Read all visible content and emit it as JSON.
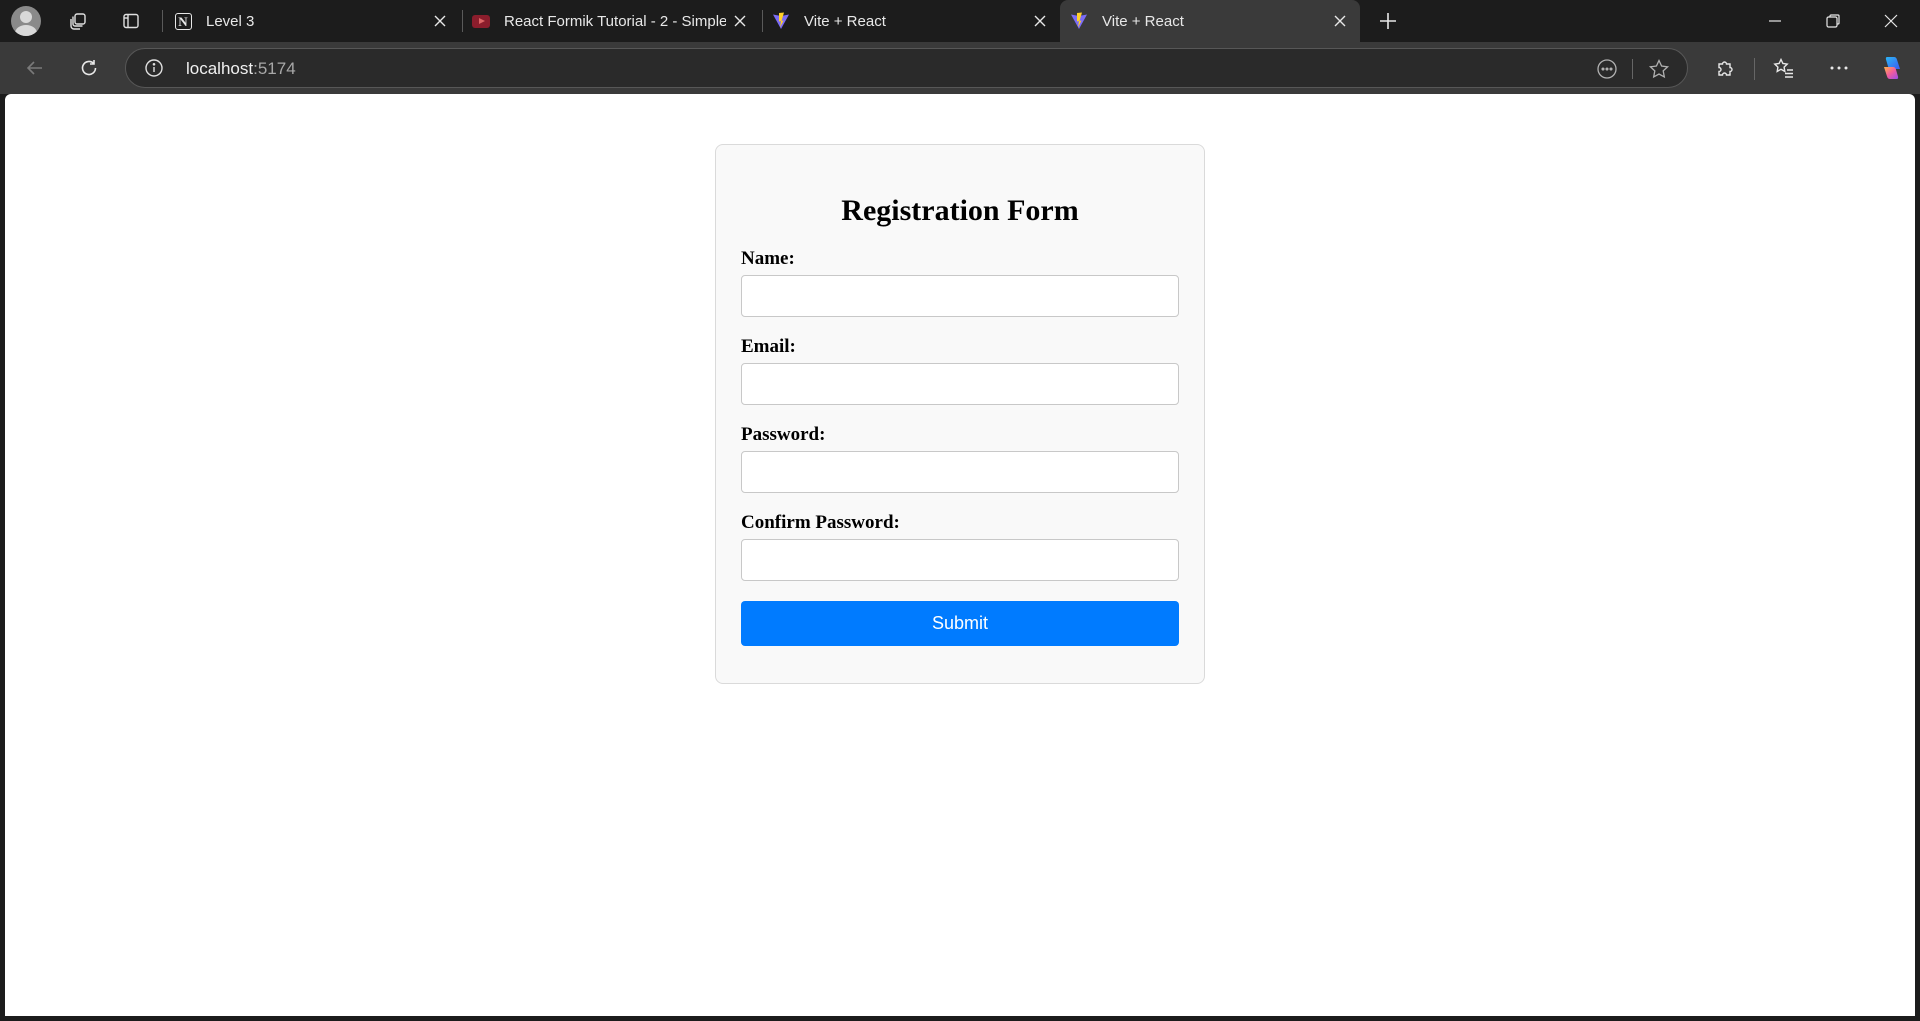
{
  "browser": {
    "tabs": [
      {
        "title": "Level 3",
        "icon": "notion-icon",
        "active": false
      },
      {
        "title": "React Formik Tutorial - 2 - Simple",
        "icon": "youtube-icon",
        "active": false
      },
      {
        "title": "Vite + React",
        "icon": "vite-icon",
        "active": false
      },
      {
        "title": "Vite + React",
        "icon": "vite-icon",
        "active": true
      }
    ],
    "address": {
      "host": "localhost",
      "port": ":5174"
    }
  },
  "form": {
    "title": "Registration Form",
    "fields": [
      {
        "label": "Name:",
        "value": ""
      },
      {
        "label": "Email:",
        "value": ""
      },
      {
        "label": "Password:",
        "value": ""
      },
      {
        "label": "Confirm Password:",
        "value": ""
      }
    ],
    "submit_label": "Submit"
  },
  "colors": {
    "accent": "#007bff",
    "chrome_bg": "#1c1c1c",
    "toolbar_bg": "#3a3a3a"
  }
}
